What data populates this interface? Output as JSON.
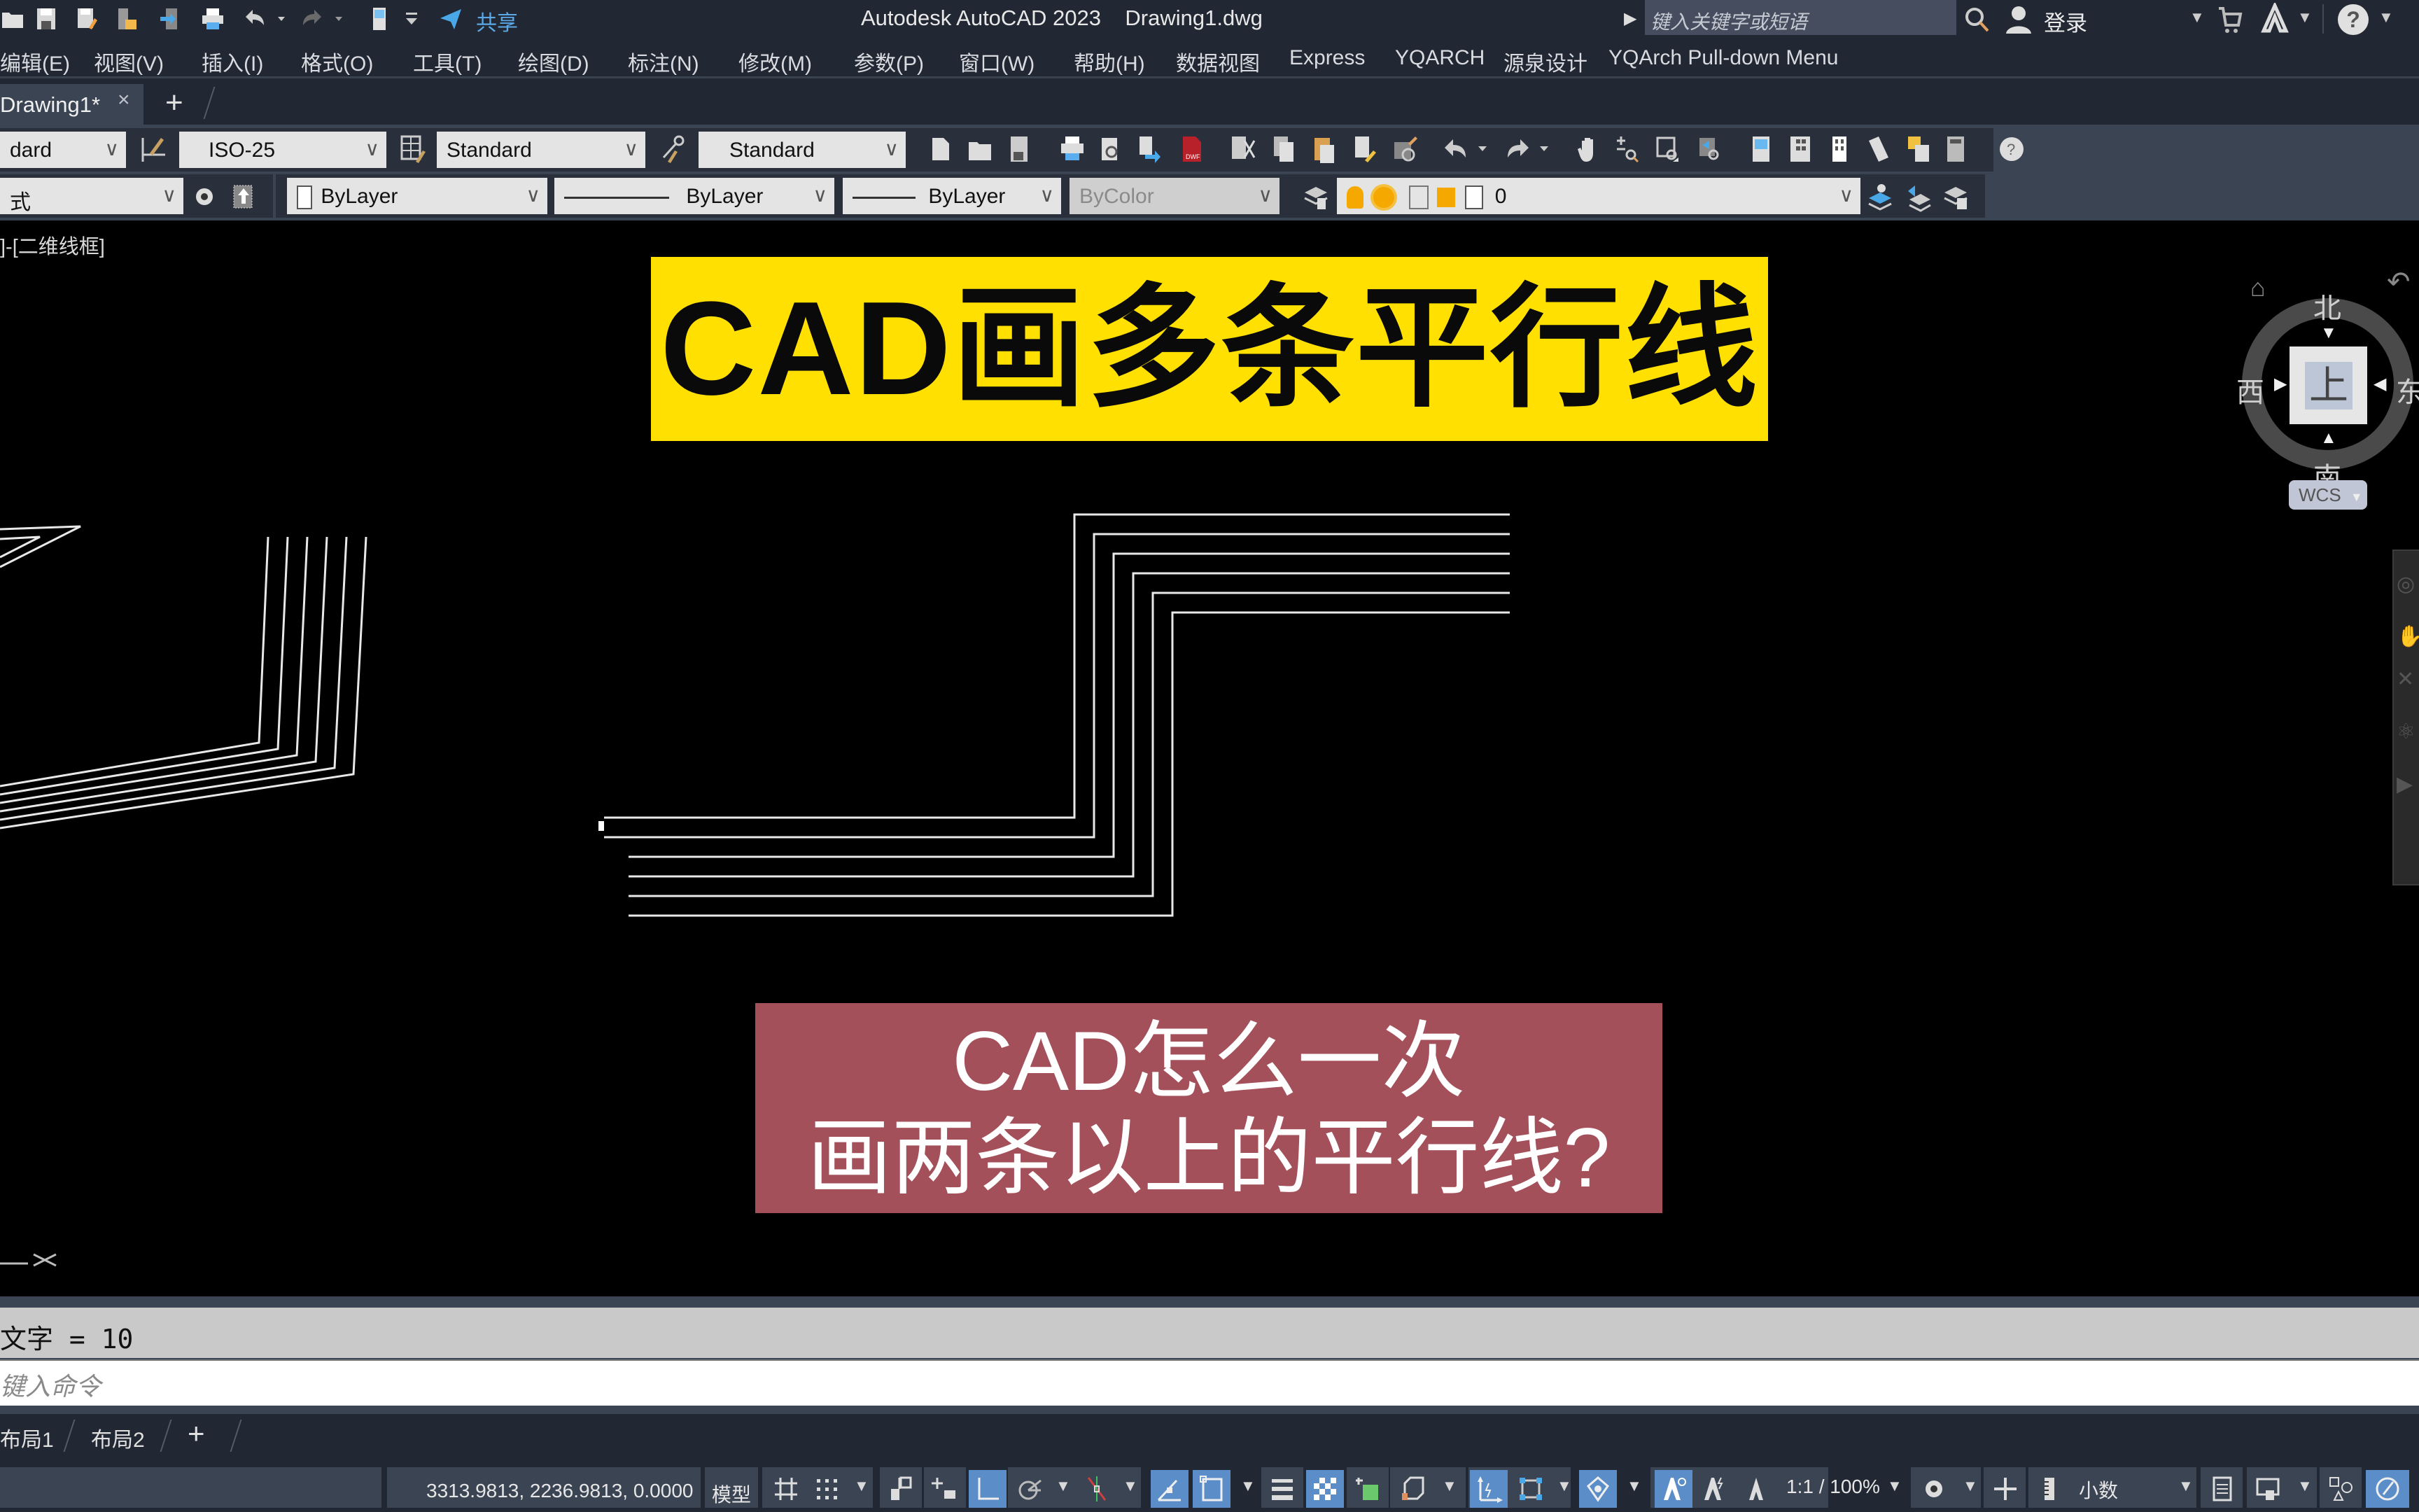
{
  "titlebar": {
    "app_title": "Autodesk AutoCAD 2023    Drawing1.dwg",
    "share_label": "共享",
    "search_placeholder": "键入关键字或短语",
    "login_label": "登录",
    "quick_access_icons": [
      "open-icon",
      "save-icon",
      "save-as-icon",
      "open-from-web-icon",
      "save-to-web-icon",
      "plot-icon",
      "undo-icon",
      "redo-icon",
      "workspace-icon",
      "customize-icon",
      "share-icon"
    ]
  },
  "menubar": {
    "items": [
      "编辑(E)",
      "视图(V)",
      "插入(I)",
      "格式(O)",
      "工具(T)",
      "绘图(D)",
      "标注(N)",
      "修改(M)",
      "参数(P)",
      "窗口(W)",
      "帮助(H)",
      "数据视图",
      "Express",
      "YQARCH",
      "源泉设计",
      "YQArch Pull-down Menu"
    ]
  },
  "doc_tabs": {
    "active": "Drawing1*",
    "close": "×",
    "new_tab": "+"
  },
  "toolbar_row1": {
    "text_style": "dard",
    "dim_style": "ISO-25",
    "table_style": "Standard",
    "mleader_style": "Standard"
  },
  "toolbar_row2": {
    "workspace": "式",
    "color": "ByLayer",
    "linetype": "ByLayer",
    "lineweight": "ByLayer",
    "plot_style": "ByColor",
    "layer": "0"
  },
  "viewport": {
    "view_label": "]-[二维线框]",
    "banner_title": "CAD画多条平行线",
    "banner_question_line1": "CAD怎么一次",
    "banner_question_line2": "画两条以上的平行线?",
    "banner_title_color": "#ffe000",
    "banner_question_color": "#a4505a",
    "parallel_line_count": 6,
    "viewcube": {
      "north": "北",
      "south": "南",
      "west": "西",
      "east": "东",
      "face": "上",
      "wcs": "WCS"
    }
  },
  "command_line": {
    "history": "文字 = 10",
    "input_placeholder": "键入命令"
  },
  "layout_tabs": {
    "items": [
      "布局1",
      "布局2"
    ],
    "add": "+"
  },
  "statusbar": {
    "coordinates": "3313.9813, 2236.9813, 0.0000",
    "model_label": "模型",
    "annotation_scale": "1:1 / 100%",
    "units": "小数"
  }
}
